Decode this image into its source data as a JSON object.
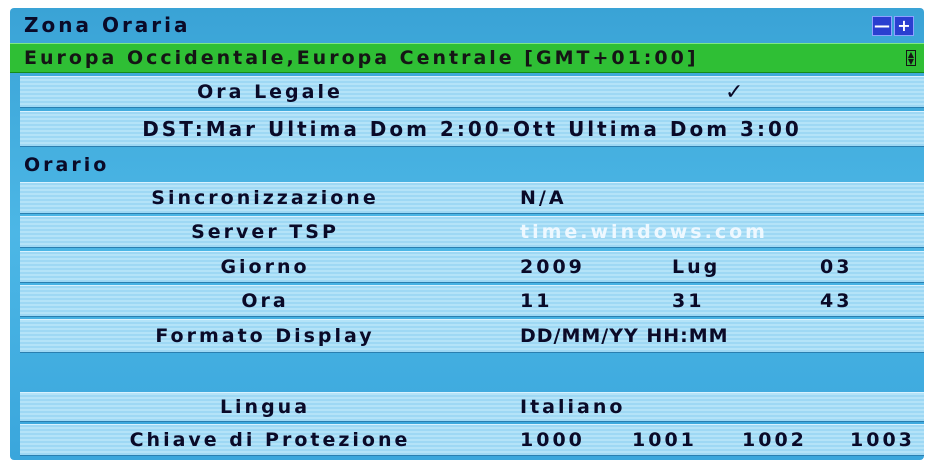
{
  "header": {
    "title": "Zona Oraria",
    "minus": "—",
    "plus": "+"
  },
  "timezone": {
    "value": "Europa Occidentale,Europa Centrale [GMT+01:00]",
    "icon": "scroll-icon"
  },
  "dst": {
    "label": "Ora Legale",
    "check": "✓",
    "rule": "DST:Mar Ultima Dom 2:00-Ott Ultima Dom 3:00"
  },
  "clock": {
    "section_title": "Orario",
    "sync_label": "Sincronizzazione",
    "sync_value": "N/A",
    "server_label": "Server TSP",
    "server_value": "time.windows.com",
    "day_label": "Giorno",
    "day_values": [
      "2009",
      "Lug",
      "03"
    ],
    "time_label": "Ora",
    "time_values": [
      "11",
      "31",
      "43"
    ],
    "format_label": "Formato Display",
    "format_value": "DD/MM/YY HH:MM"
  },
  "language": {
    "label": "Lingua",
    "value": "Italiano"
  },
  "protection": {
    "label": "Chiave di Protezione",
    "values": [
      "1000",
      "1001",
      "1002",
      "1003"
    ]
  },
  "colors": {
    "background": "#4cb7e6",
    "row": "#9ed8f4",
    "selected": "#2fbf35",
    "button": "#2a3fd0"
  }
}
